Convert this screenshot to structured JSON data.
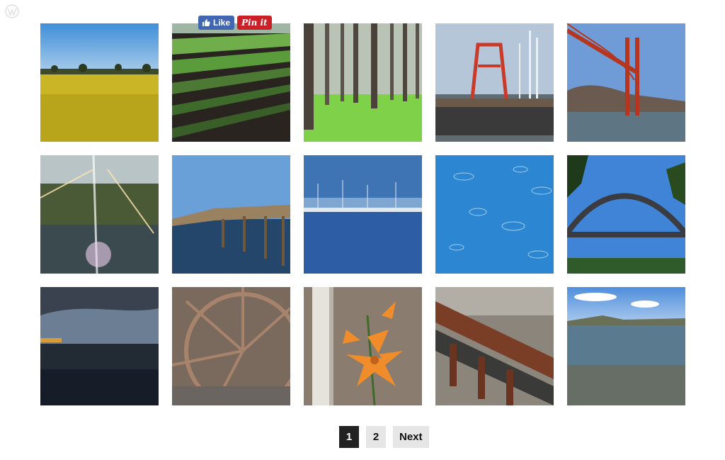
{
  "share": {
    "like_label": "Like",
    "pin_label": "Pin it",
    "facebook_color": "#4267b2",
    "pinterest_color": "#cb2027"
  },
  "gallery": {
    "tiles": [
      {
        "subject": "canola-field"
      },
      {
        "subject": "lettuce-farm-rows"
      },
      {
        "subject": "pine-forest"
      },
      {
        "subject": "pier-lifeguard-tower"
      },
      {
        "subject": "golden-gate-bridge"
      },
      {
        "subject": "sun-flare-lake"
      },
      {
        "subject": "wooden-boardwalk"
      },
      {
        "subject": "marina-boats"
      },
      {
        "subject": "rain-ripples"
      },
      {
        "subject": "harbour-bridge"
      },
      {
        "subject": "dusk-sea"
      },
      {
        "subject": "wagon-wheel"
      },
      {
        "subject": "orange-lily"
      },
      {
        "subject": "railroad-track"
      },
      {
        "subject": "rocky-shoreline"
      }
    ]
  },
  "pagination": {
    "page1": "1",
    "page2": "2",
    "next": "Next",
    "current_color": "#222222",
    "inactive_color": "#e6e6e6"
  }
}
